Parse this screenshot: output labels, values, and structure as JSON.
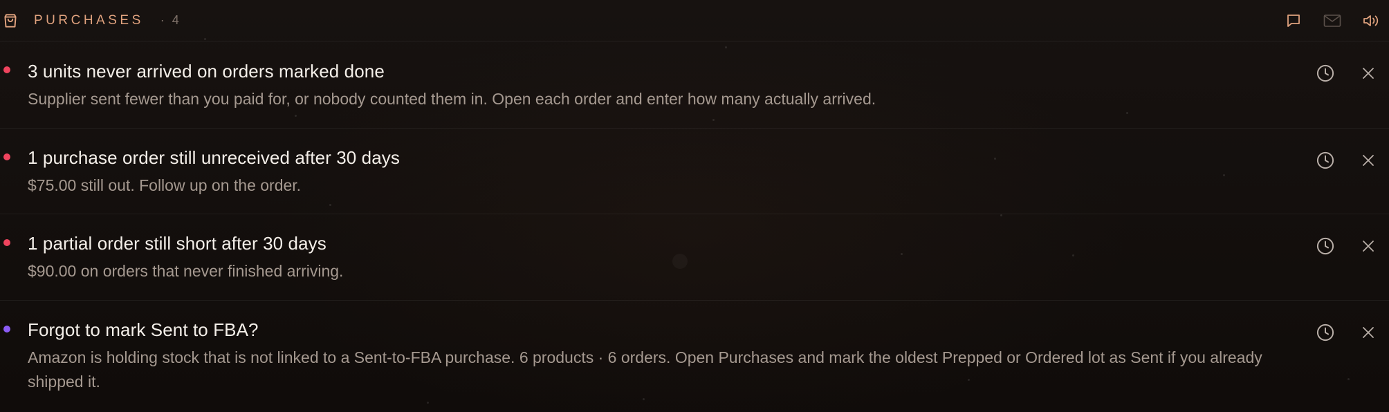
{
  "header": {
    "title": "PURCHASES",
    "count_text": "· 4",
    "icons": {
      "section": "shopping-bag-icon",
      "comment": "message-square-icon",
      "mail": "mail-icon",
      "sound": "volume-icon"
    }
  },
  "colors": {
    "accent": "#e0a27e",
    "alert_red": "#f0445e",
    "alert_purple": "#8b5cf6",
    "text_primary": "#f4efe9",
    "text_secondary": "#a59990"
  },
  "notifications": [
    {
      "title": "3 units never arrived on orders marked done",
      "description": "Supplier sent fewer than you paid for, or nobody counted them in. Open each order and enter how many actually arrived.",
      "severity_color": "#f0445e"
    },
    {
      "title": "1 purchase order still unreceived after 30 days",
      "description": "$75.00 still out. Follow up on the order.",
      "severity_color": "#f0445e"
    },
    {
      "title": "1 partial order still short after 30 days",
      "description": "$90.00 on orders that never finished arriving.",
      "severity_color": "#f0445e"
    },
    {
      "title": "Forgot to mark Sent to FBA?",
      "description": "Amazon is holding stock that is not linked to a Sent-to-FBA purchase. 6 products · 6 orders. Open Purchases and mark the oldest Prepped or Ordered lot as Sent if you already shipped it.",
      "severity_color": "#8b5cf6"
    }
  ],
  "row_icons": {
    "snooze": "clock-icon",
    "dismiss": "close-icon"
  }
}
